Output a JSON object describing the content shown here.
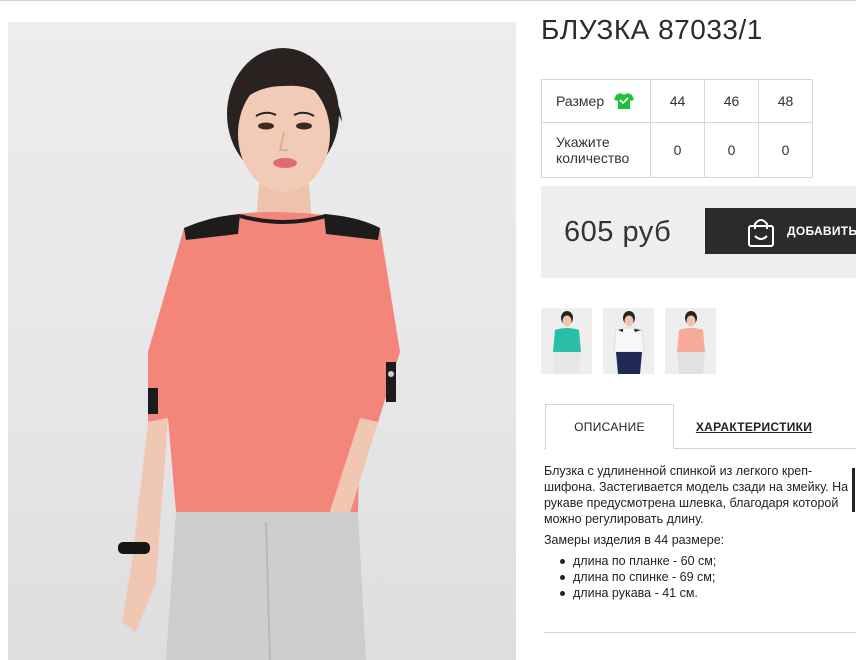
{
  "product": {
    "title": "БЛУЗКА 87033/1",
    "main_image_alt": "Блузка 87033/1 - фото модели"
  },
  "sizes": {
    "size_label": "Размер",
    "size_icon": "shirt-icon",
    "size_icon_color": "#1fbf3a",
    "quantity_label": "Укажите количество",
    "options": [
      {
        "size": "44",
        "qty": "0"
      },
      {
        "size": "46",
        "qty": "0"
      },
      {
        "size": "48",
        "qty": "0"
      }
    ]
  },
  "purchase": {
    "price": "605 руб",
    "add_label": "ДОБАВИТЬ",
    "add_icon": "shopping-bag-icon",
    "button_color": "#2b2b2b"
  },
  "thumbnails": [
    {
      "name": "turquoise-variant",
      "color": "#2bbfa9"
    },
    {
      "name": "white-variant",
      "color": "#f4f4f4"
    },
    {
      "name": "coral-variant",
      "color": "#f7a99b"
    }
  ],
  "tabs": [
    {
      "label": "ОПИСАНИЕ",
      "active": true
    },
    {
      "label": "ХАРАКТЕРИСТИКИ",
      "active": false
    }
  ],
  "description": {
    "paragraph": "Блузка с удлиненной спинкой из легкого креп-шифона. Застегивается модель сзади на змейку. На рукаве предусмотрена шлевка, благодаря которой можно регулировать длину.",
    "measurements_title": "Замеры изделия в 44 размере:",
    "measurements": [
      "длина по планке - 60 см;",
      "длина по спинке - 69 см;",
      "длина рукава - 41 см."
    ]
  },
  "colors": {
    "blouse": "#f4857a",
    "trim": "#1c1c1c",
    "pants": "#cfcccf"
  }
}
